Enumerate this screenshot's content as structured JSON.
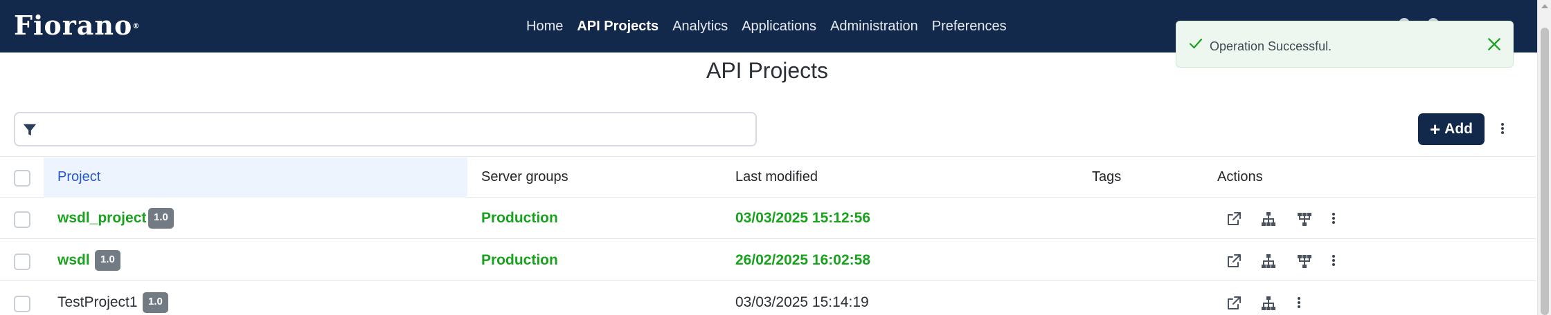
{
  "navbar": {
    "brand": "Fiorano",
    "links": [
      "Home",
      "API Projects",
      "Analytics",
      "Applications",
      "Administration",
      "Preferences"
    ],
    "active_link": "API Projects",
    "icons": [
      "help-icon",
      "user-icon"
    ]
  },
  "toast": {
    "message": "Operation Successful.",
    "icon": "check-icon",
    "close_icon": "close-icon",
    "color": "#18a21d"
  },
  "page": {
    "title": "API Projects"
  },
  "filter": {
    "icon": "filter-icon",
    "value": "",
    "placeholder": ""
  },
  "toolbar": {
    "add_label": "Add",
    "add_icon": "plus-icon",
    "more_icon": "kebab-menu-icon"
  },
  "table": {
    "columns": [
      "Project",
      "Server groups",
      "Last modified",
      "Tags",
      "Actions"
    ],
    "rows": [
      {
        "project": "wsdl_project",
        "version": "1.0",
        "server_group": "Production",
        "last_modified": "03/03/2025 15:12:56",
        "tags": "",
        "deployed": true,
        "actions": [
          "open-external-icon",
          "sitemap-icon",
          "deploy-tree-icon",
          "kebab-menu-icon"
        ]
      },
      {
        "project": "wsdl",
        "version": "1.0",
        "server_group": "Production",
        "last_modified": "26/02/2025 16:02:58",
        "tags": "",
        "deployed": true,
        "actions": [
          "open-external-icon",
          "sitemap-icon",
          "deploy-tree-icon",
          "kebab-menu-icon"
        ]
      },
      {
        "project": "TestProject1",
        "version": "1.0",
        "server_group": "",
        "last_modified": "03/03/2025 15:14:19",
        "tags": "",
        "deployed": false,
        "actions": [
          "open-external-icon",
          "sitemap-icon",
          "kebab-menu-icon"
        ]
      }
    ]
  },
  "colors": {
    "navbar": "#13294b",
    "deployed_text": "#18a21d",
    "header_highlight": "#edf4fd",
    "header_project_text": "#2457d6",
    "version_badge": "#727a84"
  }
}
